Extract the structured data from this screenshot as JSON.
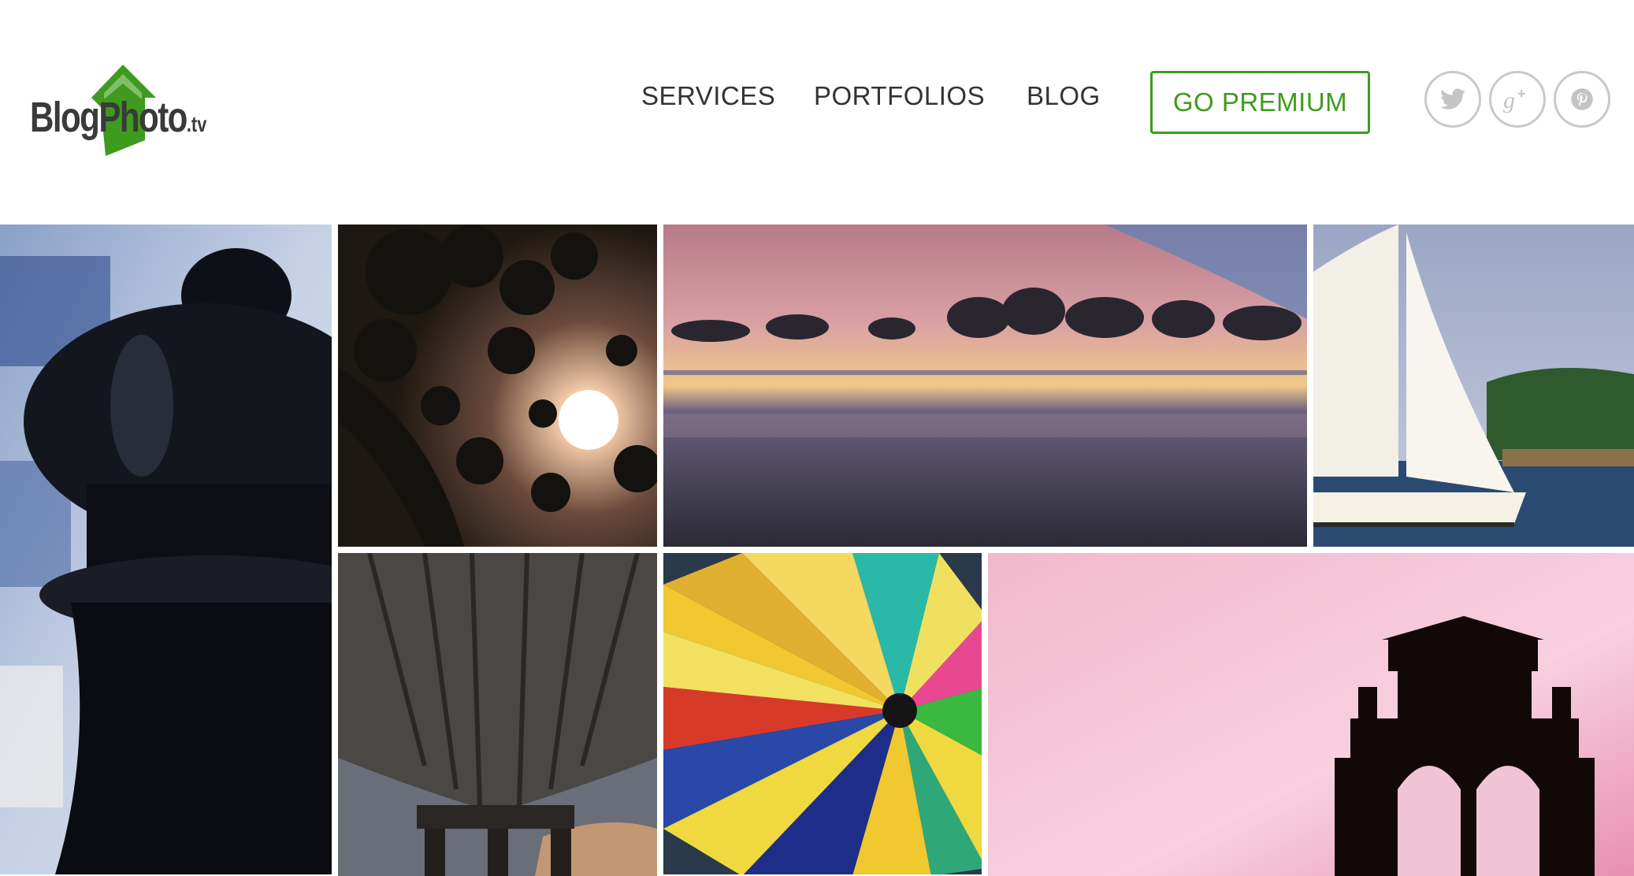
{
  "brand": {
    "logo_text": "BlogPhoto",
    "logo_tld": ".tv",
    "accent_color": "#3e9b1e"
  },
  "nav": {
    "items": [
      {
        "label": "SERVICES"
      },
      {
        "label": "PORTFOLIOS"
      },
      {
        "label": "BLOG"
      }
    ],
    "premium_label": "GO PREMIUM"
  },
  "social": [
    {
      "icon": "twitter-icon"
    },
    {
      "icon": "google-plus-icon"
    },
    {
      "icon": "pinterest-icon"
    }
  ],
  "gallery": [
    {
      "subject": "chess-piece"
    },
    {
      "subject": "moon-through-trees"
    },
    {
      "subject": "ocean-sunset"
    },
    {
      "subject": "sailboat"
    },
    {
      "subject": "under-pier"
    },
    {
      "subject": "colored-pencils"
    },
    {
      "subject": "building-silhouette-pink-sky"
    }
  ]
}
